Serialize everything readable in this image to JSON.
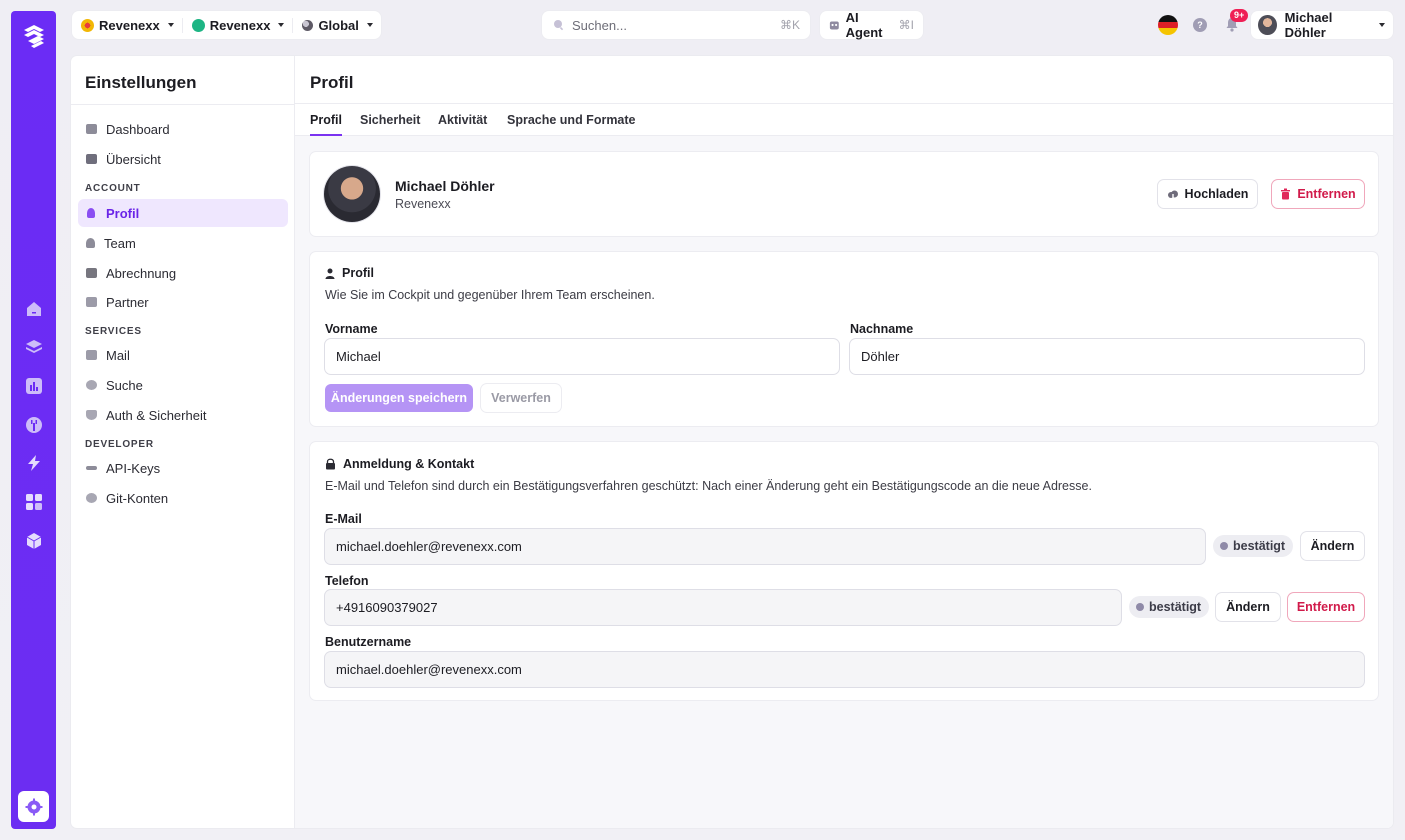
{
  "topbar": {
    "contexts": [
      {
        "label": "Revenexx",
        "color": "#f2b705"
      },
      {
        "label": "Revenexx",
        "color": "#1db584"
      },
      {
        "label": "Global",
        "color": "#5e5a66"
      }
    ],
    "search": {
      "placeholder": "Suchen...",
      "shortcut": "⌘K"
    },
    "agent": {
      "label": "AI Agent",
      "shortcut": "⌘I"
    },
    "notifications_badge": "9+",
    "help_glyph": "?",
    "user_name": "Michael Döhler"
  },
  "sidebar": {
    "title": "Einstellungen",
    "items_top": [
      {
        "label": "Dashboard",
        "icon": "dashboard-icon"
      },
      {
        "label": "Übersicht",
        "icon": "overview-icon"
      }
    ],
    "sections": [
      {
        "label": "ACCOUNT",
        "items": [
          {
            "label": "Profil",
            "icon": "user-icon",
            "active": true
          },
          {
            "label": "Team",
            "icon": "team-icon"
          },
          {
            "label": "Abrechnung",
            "icon": "billing-icon"
          },
          {
            "label": "Partner",
            "icon": "partner-icon"
          }
        ]
      },
      {
        "label": "SERVICES",
        "items": [
          {
            "label": "Mail",
            "icon": "mail-icon"
          },
          {
            "label": "Suche",
            "icon": "search-icon"
          },
          {
            "label": "Auth & Sicherheit",
            "icon": "shield-icon"
          }
        ]
      },
      {
        "label": "DEVELOPER",
        "items": [
          {
            "label": "API-Keys",
            "icon": "key-icon"
          },
          {
            "label": "Git-Konten",
            "icon": "git-icon"
          }
        ]
      }
    ]
  },
  "page": {
    "title": "Profil",
    "tabs": [
      "Profil",
      "Sicherheit",
      "Aktivität",
      "Sprache und Formate"
    ]
  },
  "profile_card": {
    "name": "Michael Döhler",
    "org": "Revenexx",
    "upload_label": "Hochladen",
    "remove_label": "Entfernen"
  },
  "profile_form": {
    "heading": "Profil",
    "description": "Wie Sie im Cockpit und gegenüber Ihrem Team erscheinen.",
    "first_name_label": "Vorname",
    "first_name_value": "Michael",
    "last_name_label": "Nachname",
    "last_name_value": "Döhler",
    "save_label": "Änderungen speichern",
    "discard_label": "Verwerfen"
  },
  "login_contact": {
    "heading": "Anmeldung & Kontakt",
    "description": "E-Mail und Telefon sind durch ein Bestätigungsverfahren geschützt: Nach einer Änderung geht ein Bestätigungscode an die neue Adresse.",
    "email_label": "E-Mail",
    "email_value": "michael.doehler@revenexx.com",
    "email_status": "bestätigt",
    "email_change": "Ändern",
    "phone_label": "Telefon",
    "phone_value": "+4916090379027",
    "phone_status": "bestätigt",
    "phone_change": "Ändern",
    "phone_remove": "Entfernen",
    "username_label": "Benutzername",
    "username_value": "michael.doehler@revenexx.com"
  },
  "colors": {
    "brand": "#6b2cf5",
    "danger": "#d11a4a",
    "active_bg": "#efe7fe"
  }
}
